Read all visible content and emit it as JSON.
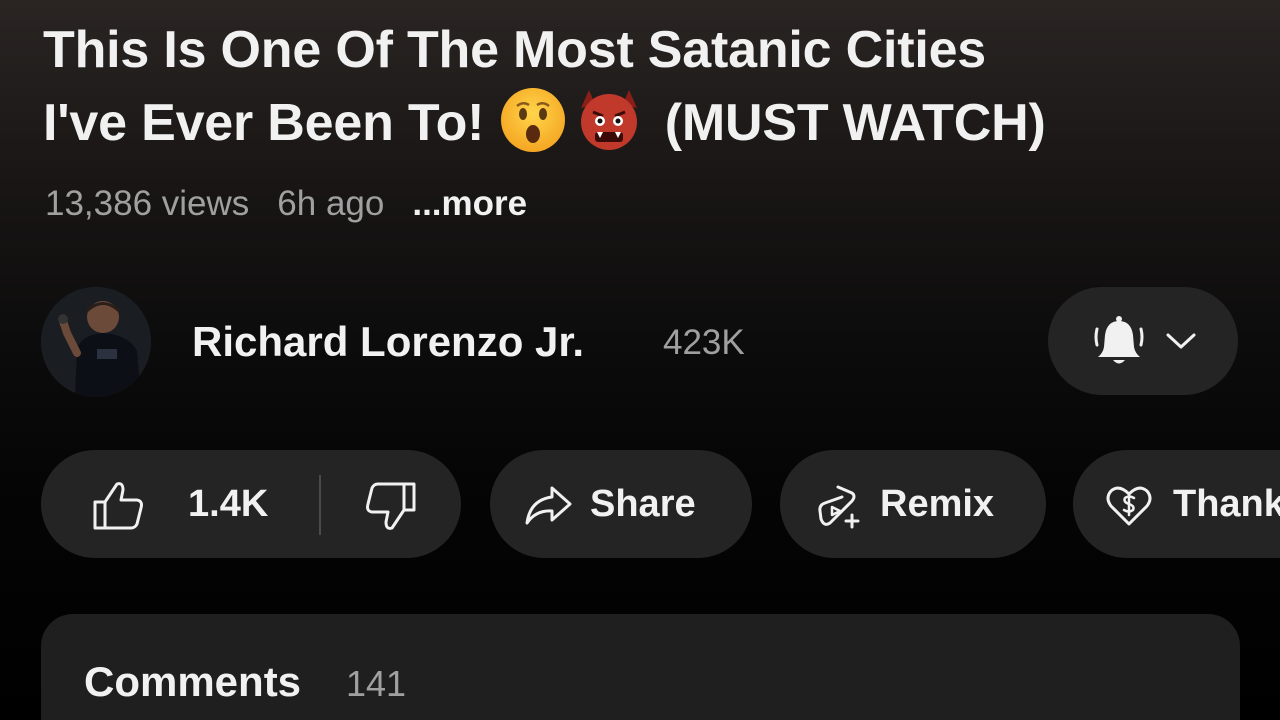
{
  "video": {
    "title_line1": "This Is One Of The Most Satanic Cities",
    "title_line2_prefix": "I've Ever Been To!",
    "title_line2_suffix": " (MUST WATCH)",
    "title_emojis": [
      "hushed-face-emoji",
      "ogre-emoji"
    ],
    "views": "13,386 views",
    "age": "6h ago",
    "more_label": "...more"
  },
  "channel": {
    "name": "Richard Lorenzo Jr.",
    "subscribers": "423K",
    "avatar": "avatar-photo",
    "bell_icon": "bell-icon",
    "chevron_icon": "chevron-down-icon"
  },
  "actions": {
    "like_count": "1.4K",
    "share_label": "Share",
    "remix_label": "Remix",
    "thanks_label": "Thanks",
    "icons": [
      "thumbs-up-icon",
      "thumbs-down-icon",
      "share-arrow-icon",
      "remix-icon",
      "thanks-heart-icon"
    ]
  },
  "comments": {
    "label": "Comments",
    "count": "141"
  },
  "colors": {
    "background_top": "#2a2523",
    "background_bottom": "#000000",
    "pill_bg": "#242424",
    "card_bg": "#1f1f1f",
    "text_primary": "#f1f1f1",
    "text_secondary": "#a0a0a0"
  }
}
